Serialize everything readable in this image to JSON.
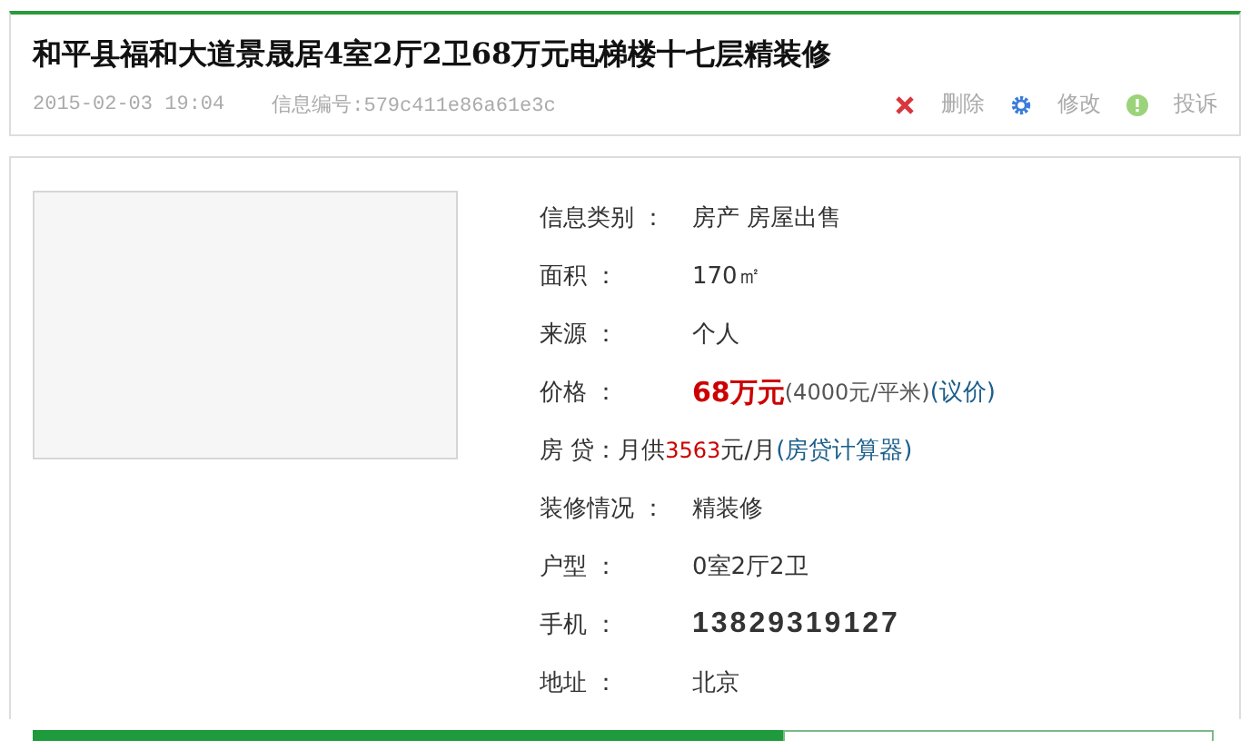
{
  "header": {
    "title": "和平县福和大道景晟居4室2厅2卫68万元电梯楼十七层精装修",
    "posted_time": "2015-02-03 19:04",
    "info_id": "信息编号:579c411e86a61e3c",
    "actions": [
      {
        "kind": "delete",
        "label": "删除"
      },
      {
        "kind": "edit",
        "label": "修改"
      },
      {
        "kind": "report",
        "label": "投诉"
      }
    ]
  },
  "details": [
    {
      "kind": "text",
      "label": "信息类别 ：",
      "value": "房产 房屋出售"
    },
    {
      "kind": "text",
      "label": "面积 ：",
      "value": "170㎡"
    },
    {
      "kind": "text",
      "label": "来源 ：",
      "value": "个人"
    },
    {
      "kind": "price",
      "label": "价格 ：",
      "value": "68万元",
      "unit_price": "(4000元/平米)",
      "link": "(议价)"
    },
    {
      "kind": "loan",
      "label": "房 贷：",
      "prefix": "月供",
      "amount": "3563",
      "suffix": "元/月",
      "link": "(房贷计算器)"
    },
    {
      "kind": "text",
      "label": "装修情况 ：",
      "value": "精装修"
    },
    {
      "kind": "text",
      "label": "户型 ：",
      "value": "0室2厅2卫"
    },
    {
      "kind": "phone",
      "label": "手机 ：",
      "value": "13829319127"
    },
    {
      "kind": "text",
      "label": "地址 ：",
      "value": "北京"
    }
  ]
}
